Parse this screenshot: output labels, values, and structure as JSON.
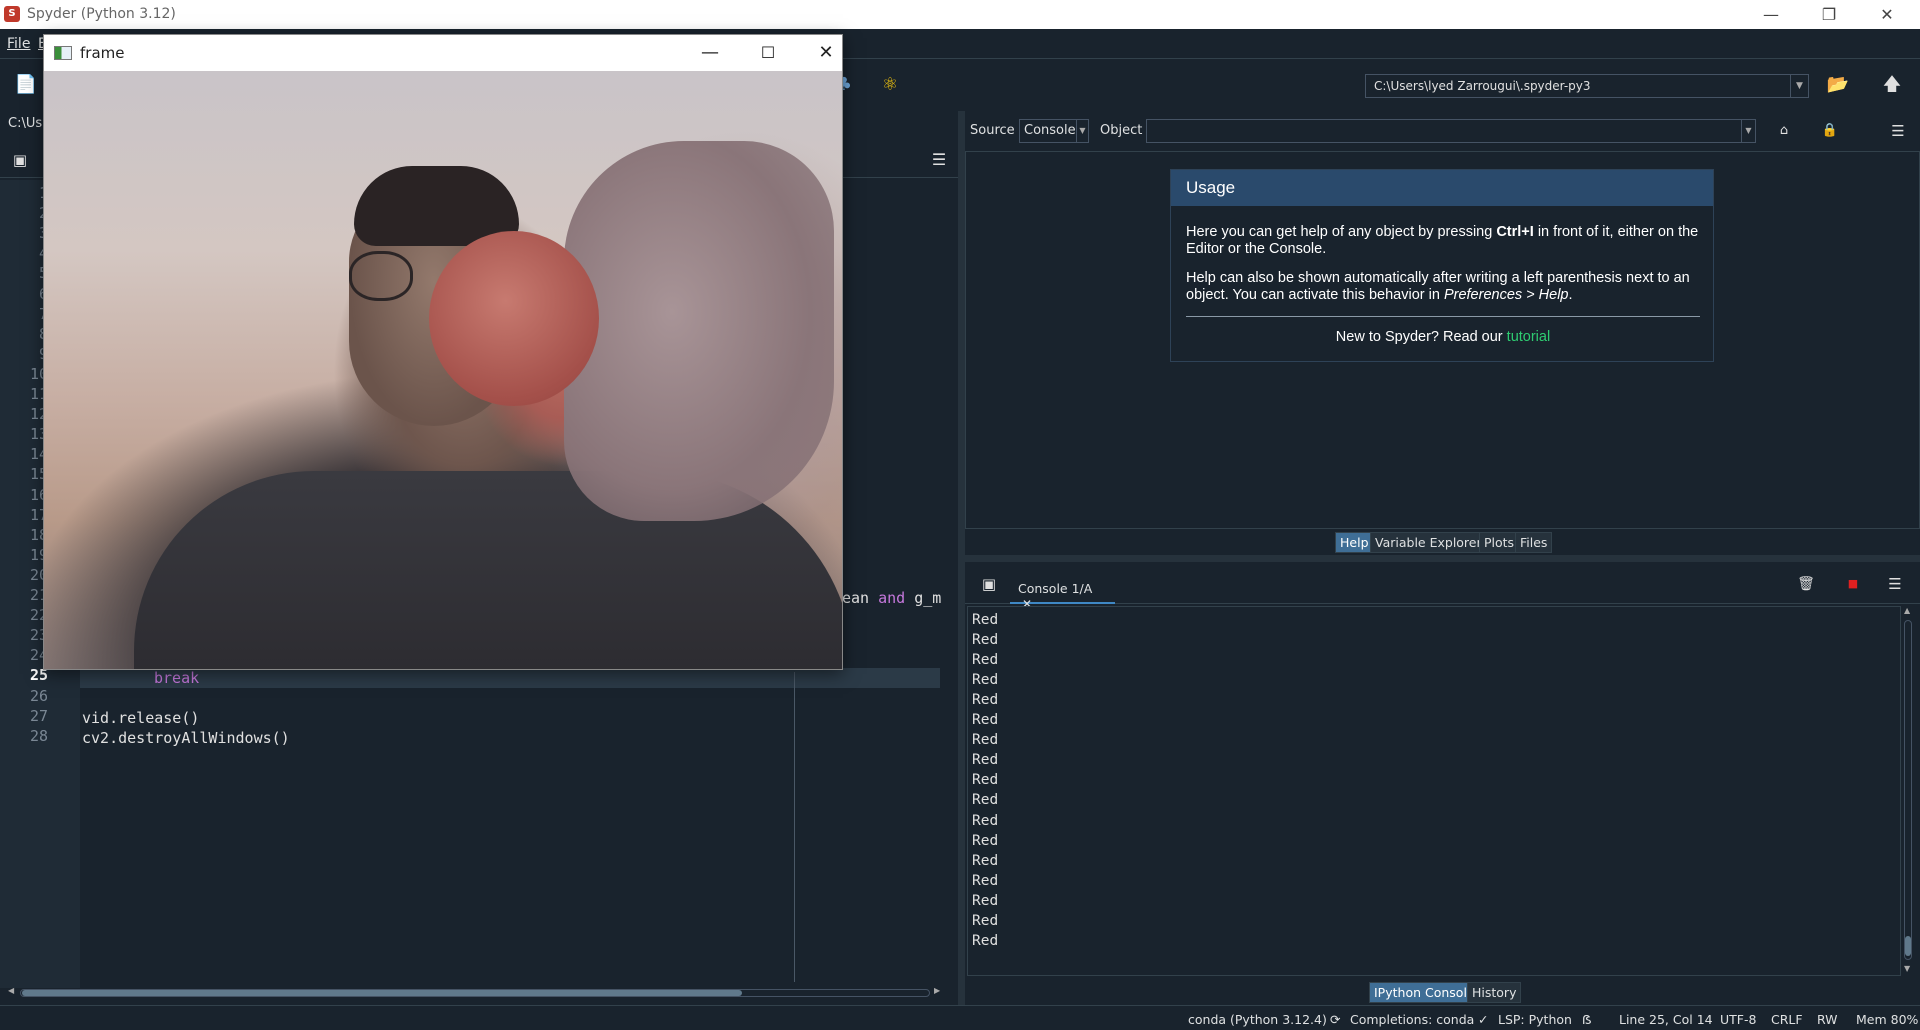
{
  "window": {
    "title": "Spyder (Python 3.12)",
    "app_icon_glyph": "S"
  },
  "menu": {
    "file": "File",
    "edit_partial": "E"
  },
  "toolbar": {
    "working_dir": "C:\\Users\\lyed Zarrougui\\.spyder-py3"
  },
  "editor": {
    "path_partial": "C:\\Us",
    "line_numbers": [
      "1",
      "2",
      "3",
      "4",
      "5",
      "6",
      "7",
      "8",
      "9",
      "10",
      "11",
      "12",
      "13",
      "14",
      "15",
      "16",
      "17",
      "18",
      "19",
      "20",
      "21",
      "22",
      "23",
      "24",
      "25",
      "26",
      "27",
      "28"
    ],
    "current_line": "25",
    "lines": {
      "l21_fragment_a": "ean ",
      "l21_keyword": "and",
      "l21_fragment_b": " g_m",
      "l25": "break",
      "l27": "vid.release()",
      "l28": "cv2.destroyAllWindows()"
    }
  },
  "frame_window": {
    "title": "frame"
  },
  "help": {
    "source_label": "Source",
    "source_value": "Console",
    "object_label": "Object",
    "usage_title": "Usage",
    "usage_p1_before": "Here you can get help of any object by pressing ",
    "usage_p1_key": "Ctrl+I",
    "usage_p1_after": " in front of it, either on the Editor or the Console.",
    "usage_p2_before": "Help can also be shown automatically after writing a left parenthesis next to an object. You can activate this behavior in ",
    "usage_p2_italic": "Preferences > Help",
    "usage_p2_after": ".",
    "usage_new_before": "New to Spyder? Read our ",
    "usage_new_link": "tutorial",
    "tabs": [
      "Help",
      "Variable Explorer",
      "Plots",
      "Files"
    ],
    "active_tab": "Help"
  },
  "console": {
    "tab_label": "Console 1/A",
    "output": [
      "Red",
      "Red",
      "Red",
      "Red",
      "Red",
      "Red",
      "Red",
      "Red",
      "Red",
      "Red",
      "Red",
      "Red",
      "Red",
      "Red",
      "Red",
      "Red",
      "Red"
    ],
    "tabs": [
      "IPython Console",
      "History"
    ],
    "active_tab": "IPython Console"
  },
  "statusbar": {
    "env": "conda (Python 3.12.4)",
    "completions": "Completions: conda",
    "lsp": "LSP: Python",
    "position": "Line 25, Col 14",
    "encoding": "UTF-8",
    "eol": "CRLF",
    "mode": "RW",
    "mem": "Mem 80%"
  },
  "colors": {
    "background": "#19232d",
    "accent": "#3f6e96",
    "keyword": "#c678dd",
    "link": "#2ecc71",
    "stop": "#e02020"
  }
}
